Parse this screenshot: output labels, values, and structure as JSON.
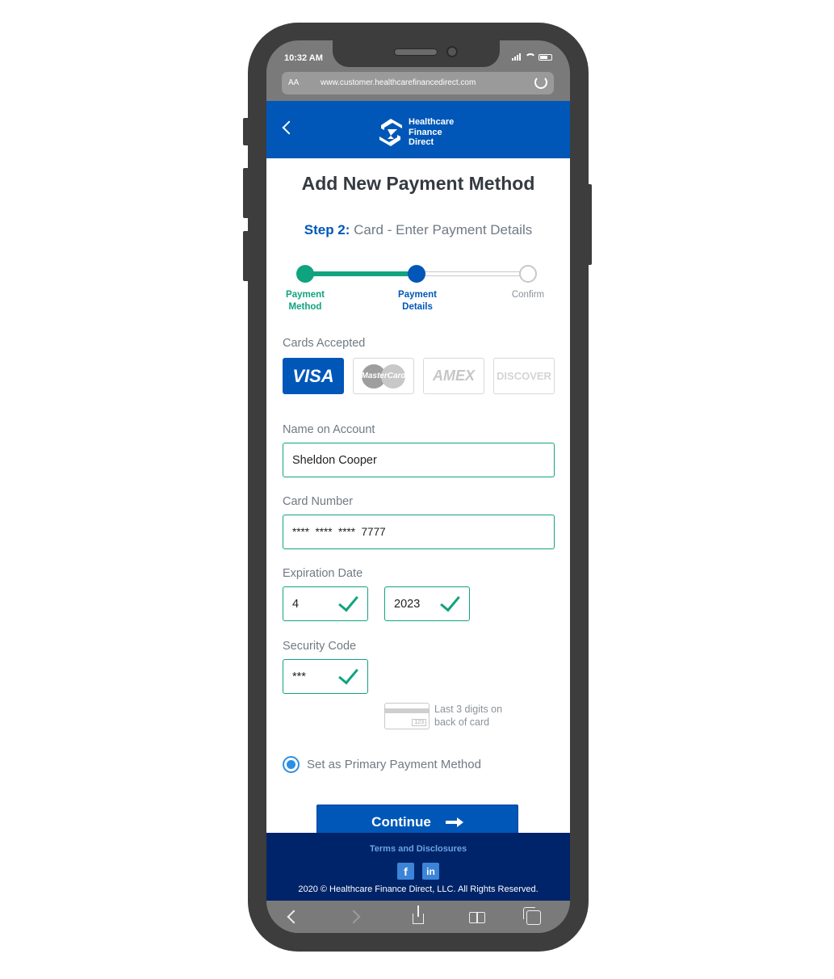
{
  "status_bar": {
    "time": "10:32 AM"
  },
  "browser": {
    "aa": "AA",
    "url": "www.customer.healthcarefinancedirect.com"
  },
  "header": {
    "brand_line1": "Healthcare",
    "brand_line2": "Finance",
    "brand_line3": "Direct"
  },
  "page": {
    "title": "Add New Payment Method",
    "step_label": "Step 2:",
    "step_text": "Card - Enter Payment Details"
  },
  "progress": {
    "steps": [
      {
        "line1": "Payment",
        "line2": "Method",
        "state": "complete"
      },
      {
        "line1": "Payment",
        "line2": "Details",
        "state": "current"
      },
      {
        "line1": "Confirm",
        "line2": "",
        "state": "pending"
      }
    ],
    "completed_fraction": 0.5
  },
  "cards_accepted": {
    "label": "Cards Accepted",
    "cards": [
      "VISA",
      "MasterCard",
      "AMEX",
      "DISCOVER"
    ],
    "selected": "VISA"
  },
  "form": {
    "name_label": "Name on Account",
    "name_value": "Sheldon Cooper",
    "card_label": "Card Number",
    "card_value": "****  ****  ****  7777",
    "exp_label": "Expiration Date",
    "exp_month": "4",
    "exp_year": "2023",
    "security_label": "Security Code",
    "security_value": "***",
    "cvv_box": "123",
    "cvv_hint_line1": "Last 3 digits on",
    "cvv_hint_line2": "back of card",
    "primary_label": "Set as Primary Payment Method",
    "primary_checked": true,
    "continue_label": "Continue"
  },
  "footer": {
    "terms": "Terms and Disclosures",
    "social": [
      "facebook-icon",
      "linkedin-icon"
    ],
    "facebook_glyph": "f",
    "linkedin_glyph": "in",
    "copyright": "2020 © Healthcare Finance Direct, LLC. All Rights Reserved."
  },
  "colors": {
    "brand_blue": "#0057b8",
    "success_green": "#10a37f",
    "footer_navy": "#002469"
  }
}
